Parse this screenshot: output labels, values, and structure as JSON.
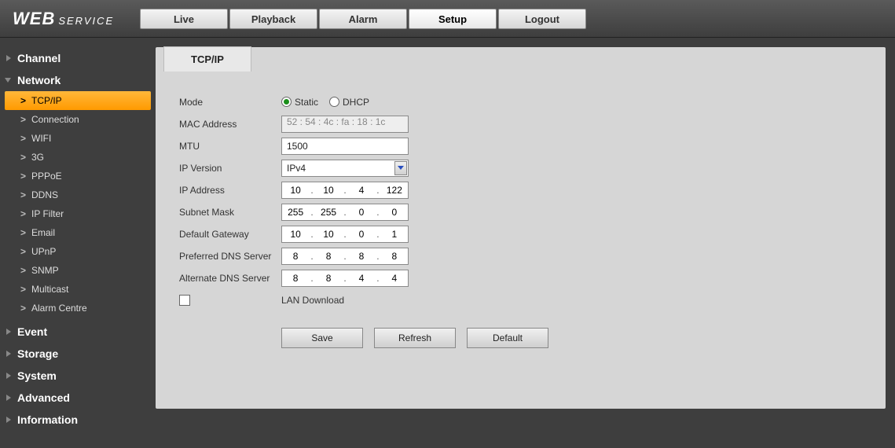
{
  "brand": {
    "main": "WEB",
    "sub": "SERVICE"
  },
  "topTabs": {
    "live": "Live",
    "playback": "Playback",
    "alarm": "Alarm",
    "setup": "Setup",
    "logout": "Logout"
  },
  "sidebar": {
    "channel": "Channel",
    "network": "Network",
    "networkItems": {
      "tcpip": "TCP/IP",
      "connection": "Connection",
      "wifi": "WIFI",
      "g3": "3G",
      "pppoe": "PPPoE",
      "ddns": "DDNS",
      "ipfilter": "IP Filter",
      "email": "Email",
      "upnp": "UPnP",
      "snmp": "SNMP",
      "multicast": "Multicast",
      "alarmcentre": "Alarm Centre"
    },
    "event": "Event",
    "storage": "Storage",
    "system": "System",
    "advanced": "Advanced",
    "information": "Information"
  },
  "panel": {
    "tab": "TCP/IP",
    "labels": {
      "mode": "Mode",
      "mac": "MAC Address",
      "mtu": "MTU",
      "ipver": "IP Version",
      "ipaddr": "IP Address",
      "subnet": "Subnet Mask",
      "gateway": "Default Gateway",
      "pdns": "Preferred DNS Server",
      "adns": "Alternate DNS Server",
      "lan": "LAN Download"
    },
    "mode": {
      "static": "Static",
      "dhcp": "DHCP",
      "selected": "static"
    },
    "mac": "52 : 54 : 4c : fa : 18 : 1c",
    "mtu": "1500",
    "ipver": "IPv4",
    "ip": {
      "a": "10",
      "b": "10",
      "c": "4",
      "d": "122"
    },
    "mask": {
      "a": "255",
      "b": "255",
      "c": "0",
      "d": "0"
    },
    "gw": {
      "a": "10",
      "b": "10",
      "c": "0",
      "d": "1"
    },
    "pdns": {
      "a": "8",
      "b": "8",
      "c": "8",
      "d": "8"
    },
    "adns": {
      "a": "8",
      "b": "8",
      "c": "4",
      "d": "4"
    },
    "buttons": {
      "save": "Save",
      "refresh": "Refresh",
      "default": "Default"
    }
  }
}
